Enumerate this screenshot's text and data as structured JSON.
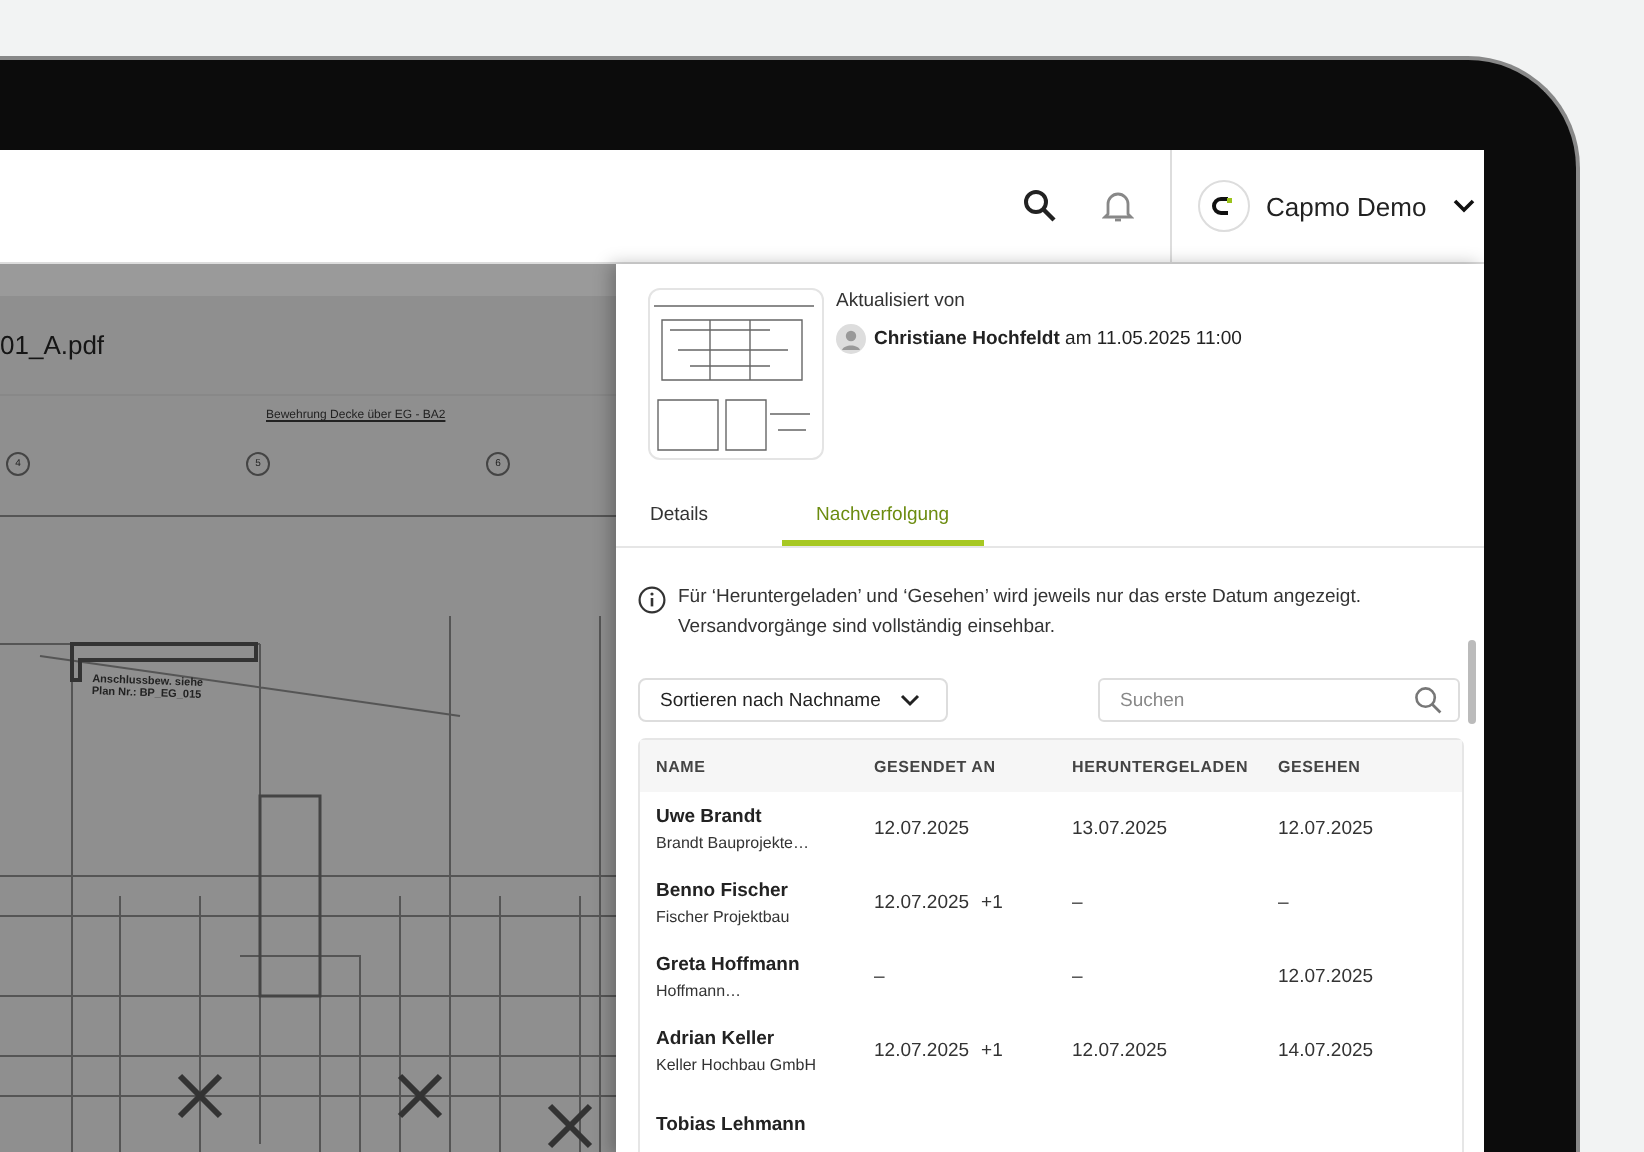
{
  "document": {
    "filename": "01_A.pdf",
    "plan_title": "Bewehrung Decke über EG - BA2",
    "axis_labels": [
      "4",
      "5",
      "6"
    ],
    "note": [
      "Anschlussbew. siehe",
      "Plan Nr.: BP_EG_015"
    ]
  },
  "header": {
    "account": "Capmo Demo"
  },
  "panel": {
    "updated_label": "Aktualisiert von",
    "updated_by": "Christiane Hochfeldt",
    "updated_at": "am 11.05.2025 11:00",
    "tabs": [
      {
        "label": "Details",
        "selected": false
      },
      {
        "label": "Nachverfolgung",
        "selected": true
      }
    ],
    "info": "Für ‘Heruntergeladen’ und ‘Gesehen’ wird jeweils nur das erste Datum angezeigt. Versandvorgänge sind vollständig einsehbar.",
    "sort": {
      "prefix": "Sortieren nach",
      "value": "Nachname"
    },
    "search": {
      "placeholder": "Suchen"
    },
    "table": {
      "columns": [
        "NAME",
        "GESENDET AN",
        "HERUNTERGELADEN",
        "GESEHEN"
      ],
      "rows": [
        {
          "name": "Uwe Brandt",
          "company": "Brandt Bauprojekte…",
          "sent": "12.07.2025",
          "sent_extra": "",
          "downloaded": "13.07.2025",
          "seen": "12.07.2025"
        },
        {
          "name": "Benno Fischer",
          "company": "Fischer Projektbau",
          "sent": "12.07.2025",
          "sent_extra": "+1",
          "downloaded": "–",
          "seen": "–"
        },
        {
          "name": "Greta Hoffmann",
          "company": "Hoffmann…",
          "sent": "–",
          "sent_extra": "",
          "downloaded": "–",
          "seen": "12.07.2025"
        },
        {
          "name": "Adrian Keller",
          "company": "Keller Hochbau GmbH",
          "sent": "12.07.2025",
          "sent_extra": "+1",
          "downloaded": "12.07.2025",
          "seen": "14.07.2025"
        },
        {
          "name": "Tobias Lehmann",
          "company": "",
          "sent": "",
          "sent_extra": "",
          "downloaded": "",
          "seen": ""
        }
      ]
    }
  }
}
